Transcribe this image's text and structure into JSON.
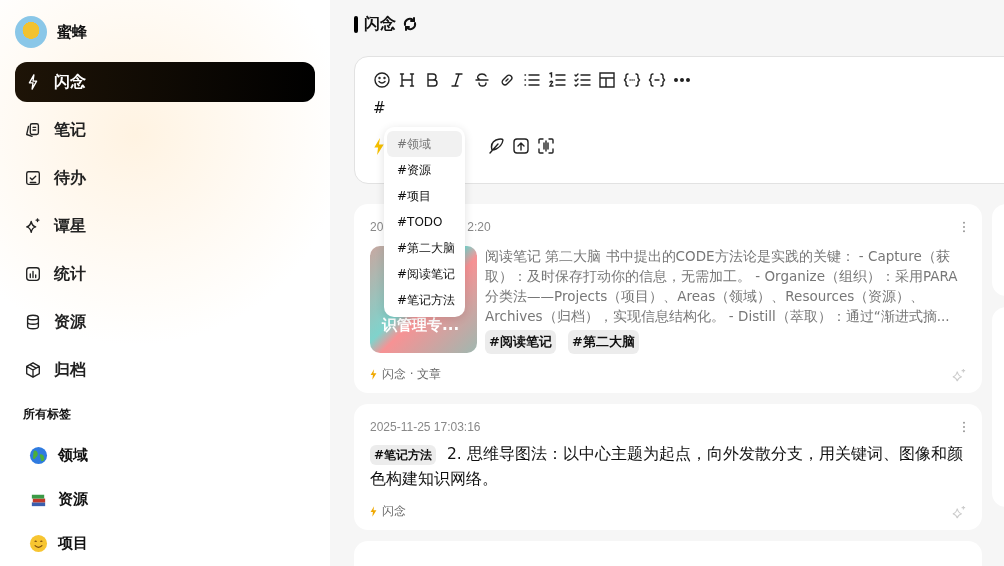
{
  "user": {
    "name": "蜜蜂"
  },
  "sidebar": {
    "items": [
      {
        "label": "闪念",
        "selected": true
      },
      {
        "label": "笔记",
        "selected": false
      },
      {
        "label": "待办",
        "selected": false
      },
      {
        "label": "谭星",
        "selected": false
      },
      {
        "label": "统计",
        "selected": false
      },
      {
        "label": "资源",
        "selected": false
      },
      {
        "label": "归档",
        "selected": false
      }
    ],
    "tags_heading": "所有标签",
    "tags": [
      {
        "label": "领域"
      },
      {
        "label": "资源"
      },
      {
        "label": "项目"
      }
    ]
  },
  "header": {
    "title": "闪念"
  },
  "editor": {
    "value": "#"
  },
  "tag_dropdown": {
    "items": [
      {
        "label": "#领域",
        "selected": true
      },
      {
        "label": "#资源",
        "selected": false
      },
      {
        "label": "#项目",
        "selected": false
      },
      {
        "label": "#TODO",
        "selected": false
      },
      {
        "label": "#第二大脑",
        "selected": false
      },
      {
        "label": "#阅读笔记",
        "selected": false
      },
      {
        "label": "#笔记方法",
        "selected": false
      }
    ]
  },
  "cards": [
    {
      "kind": "article",
      "time_start": "20",
      "time_end": "2:20",
      "thumbnail_text": "识管理专...",
      "text": "阅读笔记 第二大脑 书中提出的CODE方法论是实践的关键： - Capture（获取）：及时保存打动你的信息，无需加工。 - Organize（组织）：采用PARA分类法——Projects（项目）、Areas（领域）、Resources（资源）、Archives（归档），实现信息结构化。 - Distill（萃取）：通过“渐进式摘...",
      "tags": [
        "#阅读笔记",
        "#第二大脑"
      ],
      "footer": "闪念 · 文章"
    },
    {
      "kind": "note",
      "time": "2025-11-25 17:03:16",
      "tags": [
        "#笔记方法"
      ],
      "text": "2. 思维导图法：以中心主题为起点，向外发散分支，用关键词、图像和颜色构建知识网络。",
      "footer": "闪念"
    }
  ]
}
